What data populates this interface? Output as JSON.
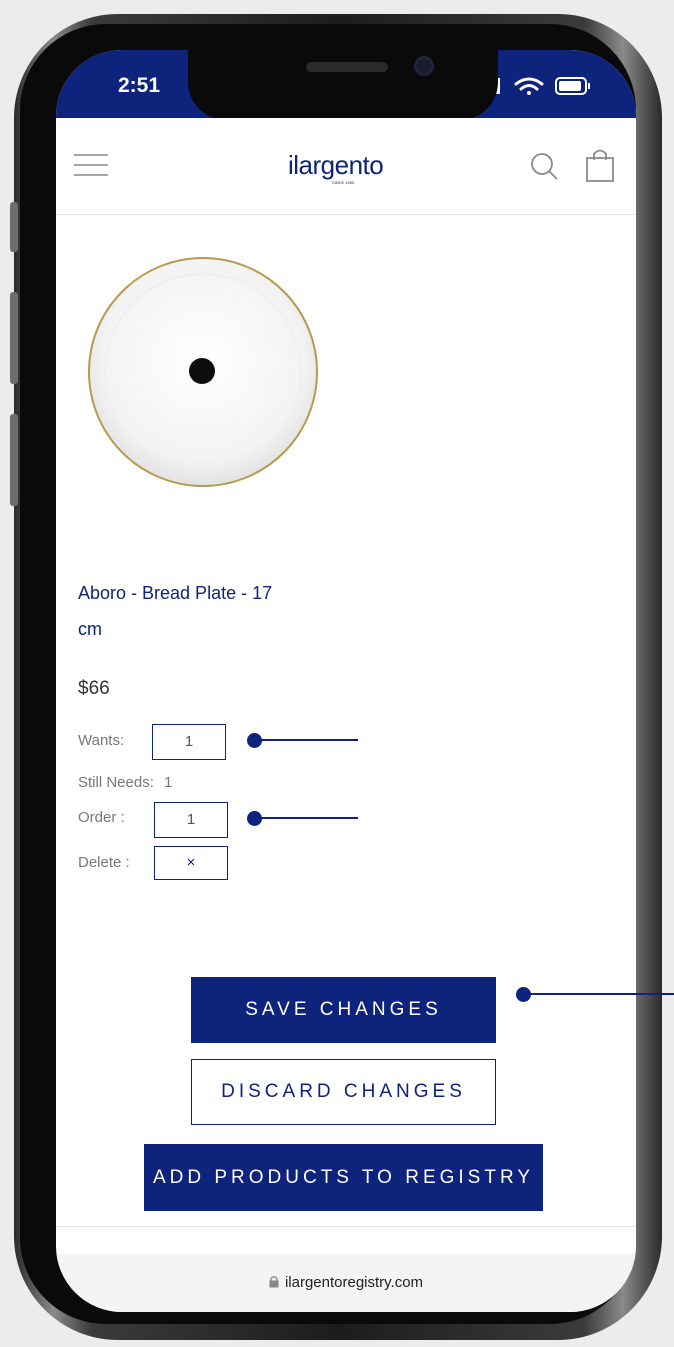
{
  "status_bar": {
    "time": "2:51",
    "icons": [
      "signal-icon",
      "wifi-icon",
      "battery-icon"
    ]
  },
  "header": {
    "logo": "ilargento",
    "logo_sub": "SINCE 1950",
    "icons": [
      "hamburger-menu-icon",
      "search-icon",
      "shopping-bag-icon"
    ]
  },
  "product": {
    "image": "bread-plate-image",
    "title_line1": "Aboro - Bread Plate - 17",
    "title_line2": "cm",
    "price": "$66",
    "wants_label": "Wants:",
    "wants_value": "1",
    "still_needs_label": "Still Needs:",
    "still_needs_value": "1",
    "order_label": "Order :",
    "order_value": "1",
    "delete_label": "Delete :",
    "delete_symbol": "×"
  },
  "actions": {
    "save": "SAVE CHANGES",
    "discard": "DISCARD CHANGES",
    "add_products": "ADD PRODUCTS TO REGISTRY"
  },
  "browser": {
    "url": "ilargentoregistry.com",
    "lock_icon": "lock-icon"
  },
  "colors": {
    "brand": "#0d237c",
    "background": "#ffffff"
  }
}
